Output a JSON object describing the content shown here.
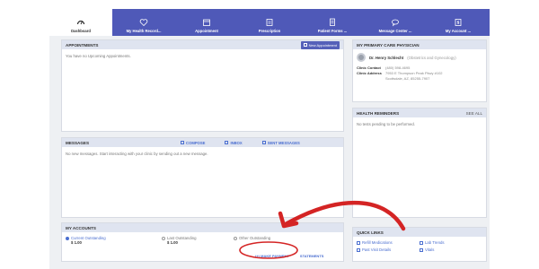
{
  "nav": {
    "tabs": [
      {
        "label": "Dashboard",
        "icon": "gauge-icon"
      },
      {
        "label": "My Health Record...",
        "icon": "heart-icon"
      },
      {
        "label": "Appointment",
        "icon": "calendar-icon"
      },
      {
        "label": "Prescription",
        "icon": "pills-icon"
      },
      {
        "label": "Patient Forms ...",
        "icon": "form-icon"
      },
      {
        "label": "Message Center ...",
        "icon": "chat-icon"
      },
      {
        "label": "My Account ...",
        "icon": "account-icon"
      }
    ]
  },
  "appointments": {
    "title": "APPOINTMENTS",
    "button": "New Appointment",
    "empty": "You have no Upcoming Appointments."
  },
  "messages": {
    "title": "MESSAGES",
    "compose": "COMPOSE",
    "inbox": "INBOX",
    "sent": "SENT MESSAGES",
    "empty": "No new messages. Start interacting with your clinic by sending out a new message."
  },
  "accounts": {
    "title": "MY ACCOUNTS",
    "options": [
      {
        "label": "Current Outstanding",
        "amount": "$ 1.00",
        "selected": true
      },
      {
        "label": "Last Outstanding",
        "amount": "$ 1.00",
        "selected": false
      },
      {
        "label": "Other Outstanding",
        "amount": "",
        "selected": false
      }
    ],
    "make_payment": "(+) MAKE PAYMENT",
    "statements": "STATEMENTS"
  },
  "physician": {
    "title": "MY PRIMARY CARE PHYSICIAN",
    "name": "Dr. Henry Schlecht",
    "specialty": "(Obstetrics and Gynecology)",
    "contact_label": "Clinic Contact",
    "contact_value": "(480) 598-4695",
    "address_label": "Clinic Address",
    "address_line1": "7953 E Thompson Peak Pkwy #102",
    "address_line2": "Scottsdale, AZ, 85255-7907"
  },
  "health_reminders": {
    "title": "HEALTH REMINDERS",
    "see_all": "SEE ALL",
    "empty": "No tests pending to be performed."
  },
  "quick_links": {
    "title": "QUICK LINKS",
    "links": [
      "Refill Medications",
      "Lab Trends",
      "Past Visit Details",
      "Vitals"
    ]
  },
  "colors": {
    "nav": "#4f59b8",
    "link": "#4a6ed0",
    "annotation": "#d42424"
  }
}
